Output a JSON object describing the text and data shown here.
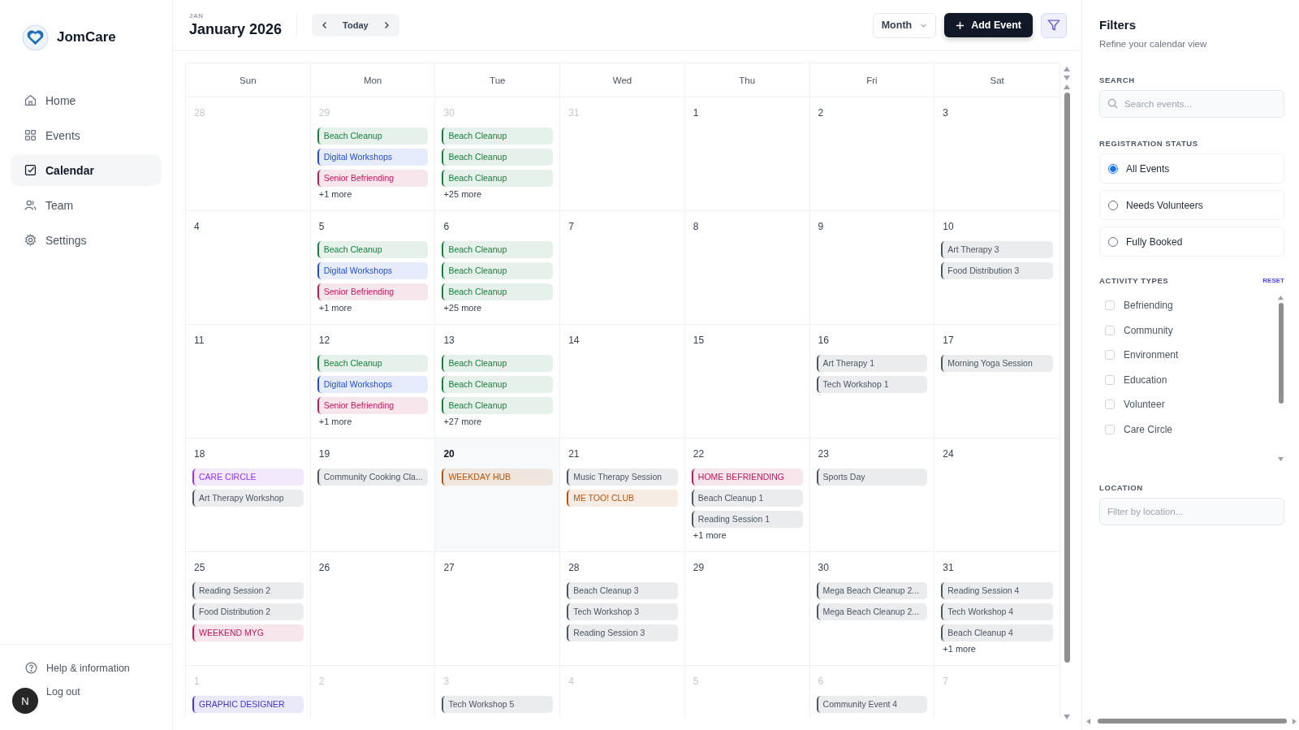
{
  "brand": {
    "name": "JomCare"
  },
  "nav": [
    {
      "label": "Home",
      "selected": false
    },
    {
      "label": "Events",
      "selected": false
    },
    {
      "label": "Calendar",
      "selected": true
    },
    {
      "label": "Team",
      "selected": false
    },
    {
      "label": "Settings",
      "selected": false
    }
  ],
  "footer": {
    "help": "Help & information",
    "avatar": "N",
    "logout": "Log out"
  },
  "header": {
    "month_short": "JAN",
    "title": "January 2026",
    "today": "Today",
    "view": "Month",
    "add": "Add Event",
    "filter_active": true
  },
  "weekdays": [
    "Sun",
    "Mon",
    "Tue",
    "Wed",
    "Thu",
    "Fri",
    "Sat"
  ],
  "weeks": [
    [
      {
        "day": "28",
        "muted": true
      },
      {
        "day": "29",
        "muted": true,
        "events": [
          {
            "title": "Beach Cleanup",
            "color": "#15803d"
          },
          {
            "title": "Digital Workshops",
            "color": "#1d4ed8"
          },
          {
            "title": "Senior Befriending",
            "color": "#be185d"
          }
        ],
        "more": "+1 more"
      },
      {
        "day": "30",
        "muted": true,
        "events": [
          {
            "title": "Beach Cleanup",
            "color": "#15803d"
          },
          {
            "title": "Beach Cleanup",
            "color": "#15803d"
          },
          {
            "title": "Beach Cleanup",
            "color": "#15803d"
          }
        ],
        "more": "+25 more"
      },
      {
        "day": "31",
        "muted": true
      },
      {
        "day": "1",
        "muted": false
      },
      {
        "day": "2",
        "muted": false
      },
      {
        "day": "3",
        "muted": false
      }
    ],
    [
      {
        "day": "4",
        "muted": false
      },
      {
        "day": "5",
        "muted": false,
        "events": [
          {
            "title": "Beach Cleanup",
            "color": "#15803d"
          },
          {
            "title": "Digital Workshops",
            "color": "#1d4ed8"
          },
          {
            "title": "Senior Befriending",
            "color": "#be185d"
          }
        ],
        "more": "+1 more"
      },
      {
        "day": "6",
        "muted": false,
        "events": [
          {
            "title": "Beach Cleanup",
            "color": "#15803d"
          },
          {
            "title": "Beach Cleanup",
            "color": "#15803d"
          },
          {
            "title": "Beach Cleanup",
            "color": "#15803d"
          }
        ],
        "more": "+25 more"
      },
      {
        "day": "7",
        "muted": false
      },
      {
        "day": "8",
        "muted": false
      },
      {
        "day": "9",
        "muted": false
      },
      {
        "day": "10",
        "muted": false,
        "events": [
          {
            "title": "Art Therapy 3",
            "color": "#4b5563"
          },
          {
            "title": "Food Distribution 3",
            "color": "#4b5563"
          }
        ]
      }
    ],
    [
      {
        "day": "11",
        "muted": false
      },
      {
        "day": "12",
        "muted": false,
        "events": [
          {
            "title": "Beach Cleanup",
            "color": "#15803d"
          },
          {
            "title": "Digital Workshops",
            "color": "#1d4ed8"
          },
          {
            "title": "Senior Befriending",
            "color": "#be185d"
          }
        ],
        "more": "+1 more"
      },
      {
        "day": "13",
        "muted": false,
        "events": [
          {
            "title": "Beach Cleanup",
            "color": "#15803d"
          },
          {
            "title": "Beach Cleanup",
            "color": "#15803d"
          },
          {
            "title": "Beach Cleanup",
            "color": "#15803d"
          }
        ],
        "more": "+27 more"
      },
      {
        "day": "14",
        "muted": false
      },
      {
        "day": "15",
        "muted": false
      },
      {
        "day": "16",
        "muted": false,
        "events": [
          {
            "title": "Art Therapy 1",
            "color": "#4b5563"
          },
          {
            "title": "Tech Workshop 1",
            "color": "#4b5563"
          }
        ]
      },
      {
        "day": "17",
        "muted": false,
        "events": [
          {
            "title": "Morning Yoga Session",
            "color": "#4b5563"
          }
        ]
      }
    ],
    [
      {
        "day": "18",
        "muted": false,
        "events": [
          {
            "title": "CARE CIRCLE",
            "color": "#9333ea"
          },
          {
            "title": "Art Therapy Workshop",
            "color": "#4b5563"
          }
        ]
      },
      {
        "day": "19",
        "muted": false,
        "events": [
          {
            "title": "Community Cooking Cla...",
            "color": "#4b5563"
          }
        ]
      },
      {
        "day": "20",
        "muted": false,
        "today": true,
        "events": [
          {
            "title": "WEEKDAY HUB",
            "color": "#b45309"
          }
        ]
      },
      {
        "day": "21",
        "muted": false,
        "events": [
          {
            "title": "Music Therapy Session",
            "color": "#4b5563"
          },
          {
            "title": "ME TOO! CLUB",
            "color": "#b45309"
          }
        ]
      },
      {
        "day": "22",
        "muted": false,
        "events": [
          {
            "title": "HOME BEFRIENDING",
            "color": "#be185d"
          },
          {
            "title": "Beach Cleanup 1",
            "color": "#4b5563"
          },
          {
            "title": "Reading Session 1",
            "color": "#4b5563"
          }
        ],
        "more": "+1 more"
      },
      {
        "day": "23",
        "muted": false,
        "events": [
          {
            "title": "Sports Day",
            "color": "#4b5563"
          }
        ]
      },
      {
        "day": "24",
        "muted": false
      }
    ],
    [
      {
        "day": "25",
        "muted": false,
        "events": [
          {
            "title": "Reading Session 2",
            "color": "#4b5563"
          },
          {
            "title": "Food Distribution 2",
            "color": "#4b5563"
          },
          {
            "title": "WEEKEND MYG",
            "color": "#be185d"
          }
        ]
      },
      {
        "day": "26",
        "muted": false
      },
      {
        "day": "27",
        "muted": false
      },
      {
        "day": "28",
        "muted": false,
        "events": [
          {
            "title": "Beach Cleanup 3",
            "color": "#4b5563"
          },
          {
            "title": "Tech Workshop 3",
            "color": "#4b5563"
          },
          {
            "title": "Reading Session 3",
            "color": "#4b5563"
          }
        ]
      },
      {
        "day": "29",
        "muted": false
      },
      {
        "day": "30",
        "muted": false,
        "events": [
          {
            "title": "Mega Beach Cleanup 2...",
            "color": "#4b5563"
          },
          {
            "title": "Mega Beach Cleanup 2...",
            "color": "#4b5563"
          }
        ]
      },
      {
        "day": "31",
        "muted": false,
        "events": [
          {
            "title": "Reading Session 4",
            "color": "#4b5563"
          },
          {
            "title": "Tech Workshop 4",
            "color": "#4b5563"
          },
          {
            "title": "Beach Cleanup 4",
            "color": "#4b5563"
          }
        ],
        "more": "+1 more"
      }
    ],
    [
      {
        "day": "1",
        "muted": true,
        "events": [
          {
            "title": "GRAPHIC DESIGNER",
            "color": "#4338ca"
          }
        ]
      },
      {
        "day": "2",
        "muted": true
      },
      {
        "day": "3",
        "muted": true,
        "events": [
          {
            "title": "Tech Workshop 5",
            "color": "#4b5563"
          }
        ]
      },
      {
        "day": "4",
        "muted": true
      },
      {
        "day": "5",
        "muted": true
      },
      {
        "day": "6",
        "muted": true,
        "events": [
          {
            "title": "Community Event 4",
            "color": "#4b5563"
          }
        ]
      },
      {
        "day": "7",
        "muted": true
      }
    ]
  ],
  "filters": {
    "title": "Filters",
    "subtitle": "Refine your calendar view",
    "search_label": "SEARCH",
    "search_placeholder": "Search events...",
    "status_label": "REGISTRATION STATUS",
    "statuses": [
      {
        "label": "All Events",
        "selected": true
      },
      {
        "label": "Needs Volunteers",
        "selected": false
      },
      {
        "label": "Fully Booked",
        "selected": false
      }
    ],
    "types_label": "ACTIVITY TYPES",
    "reset": "RESET",
    "types": [
      {
        "label": "Befriending",
        "checked": false
      },
      {
        "label": "Community",
        "checked": false
      },
      {
        "label": "Environment",
        "checked": false
      },
      {
        "label": "Education",
        "checked": false
      },
      {
        "label": "Volunteer",
        "checked": false
      },
      {
        "label": "Care Circle",
        "checked": false
      }
    ],
    "location_label": "LOCATION",
    "location_placeholder": "Filter by location..."
  }
}
